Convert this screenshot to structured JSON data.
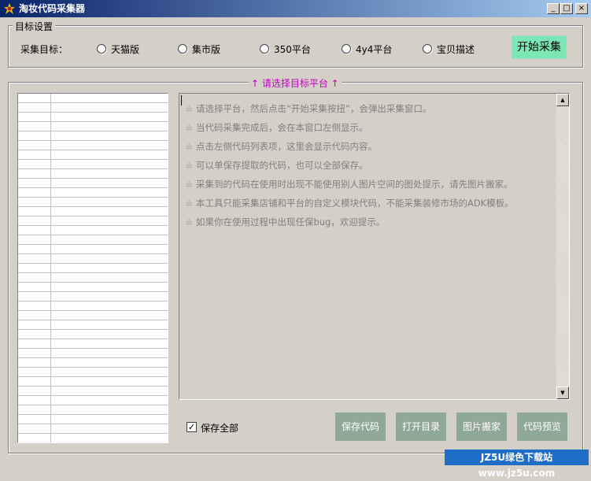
{
  "window": {
    "title": "淘妆代码采集器",
    "controls": {
      "minimize": "_",
      "maximize": "□",
      "close": "×"
    }
  },
  "target_group": {
    "legend": "目标设置",
    "label": "采集目标：",
    "options": [
      {
        "label": "天猫版"
      },
      {
        "label": "集市版"
      },
      {
        "label": "350平台"
      },
      {
        "label": "4y4平台"
      },
      {
        "label": "宝贝描述"
      }
    ],
    "start_button": "开始采集"
  },
  "platform_group": {
    "legend": "↑ 请选择目标平台 ↑",
    "legend_color": "#c000c0"
  },
  "instructions": [
    "☆ 请选择平台，然后点击“开始采集按扭”，会弹出采集窗口。",
    "☆ 当代码采集完成后，会在本窗口左侧显示。",
    "☆ 点击左侧代码列表项，这里会显示代码内容。",
    "☆ 可以单保存提取的代码，也可以全部保存。",
    "☆ 采集到的代码在使用时出现不能使用别人图片空间的图处提示，请先图片搬家。",
    "☆ 本工具只能采集店铺和平台的自定义模块代码，不能采集装修市场的ADK模板。",
    "☆ 如果你在使用过程中出现任保bug，欢迎提示。"
  ],
  "bottom": {
    "save_all_label": "保存全部",
    "save_all_checked": true,
    "buttons": [
      "保存代码",
      "打开目录",
      "图片搬家",
      "代码预览"
    ]
  },
  "watermark": "JZ5U绿色下载站www.jz5u.com",
  "colors": {
    "start_button": "#7ce6b4",
    "action_button": "#90a898",
    "titlebar_start": "#0a246a",
    "titlebar_end": "#a6caf0"
  }
}
